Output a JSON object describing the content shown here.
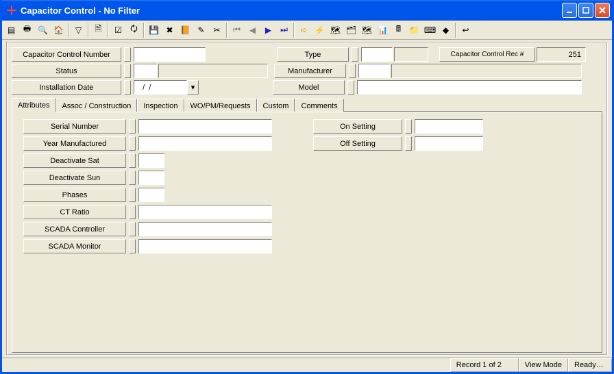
{
  "window": {
    "title": "Capacitor Control - No Filter"
  },
  "header": {
    "fields": {
      "capacitor_control_number": "Capacitor Control Number",
      "status": "Status",
      "installation_date": "Installation Date",
      "type": "Type",
      "manufacturer": "Manufacturer",
      "model": "Model",
      "rec_label": "Capacitor Control Rec #",
      "rec_value": "251",
      "date_value": "  /  /"
    }
  },
  "tabs": {
    "attributes": "Attributes",
    "assoc": "Assoc / Construction",
    "inspection": "Inspection",
    "wo": "WO/PM/Requests",
    "custom": "Custom",
    "comments": "Comments"
  },
  "attr": {
    "serial_number": "Serial Number",
    "year_manufactured": "Year Manufactured",
    "deactivate_sat": "Deactivate Sat",
    "deactivate_sun": "Deactivate Sun",
    "phases": "Phases",
    "ct_ratio": "CT Ratio",
    "scada_controller": "SCADA Controller",
    "scada_monitor": "SCADA Monitor",
    "on_setting": "On Setting",
    "off_setting": "Off Setting"
  },
  "status": {
    "record": "Record 1 of 2",
    "mode": "View Mode",
    "ready": "Ready…"
  }
}
